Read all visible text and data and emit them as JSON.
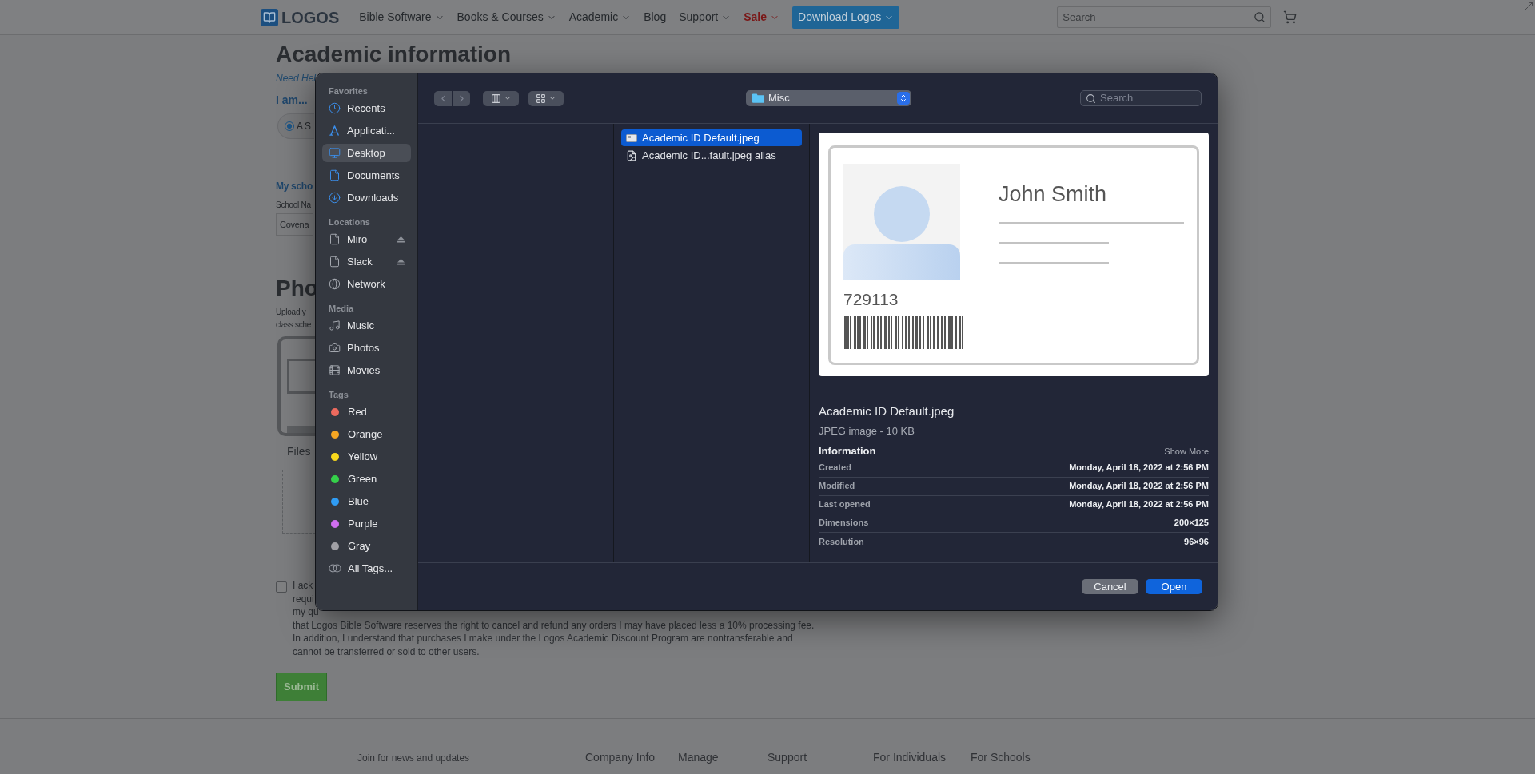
{
  "nav": {
    "logo": "LOGOS",
    "items": [
      {
        "label": "Bible Software",
        "kind": "menu"
      },
      {
        "label": "Books & Courses",
        "kind": "menu"
      },
      {
        "label": "Academic",
        "kind": "menu"
      },
      {
        "label": "Blog",
        "kind": "link"
      },
      {
        "label": "Support",
        "kind": "menu"
      },
      {
        "label": "Sale",
        "kind": "sale"
      },
      {
        "label": "Download Logos",
        "kind": "cta"
      }
    ],
    "search": {
      "placeholder": "Search"
    }
  },
  "page": {
    "title": "Academic information",
    "help_link": "Need Hel",
    "iam_label": "I am...",
    "radio": {
      "label": "A S",
      "checked": true
    },
    "school_heading": "My scho",
    "school_label": "School Na",
    "school_value": "Covena",
    "photo_heading": "Pho",
    "upload_lines": [
      "Upload y",
      "class sche"
    ],
    "files_label": "Files",
    "acknowledge": {
      "checked": false,
      "cut_lines": [
        "I ack",
        "requi",
        "my qu"
      ],
      "lines": [
        "that Logos Bible Software reserves the right to cancel and refund any orders I may have placed less a 10% processing fee.",
        "In addition, I understand that purchases I make under the Logos Academic Discount Program are nontransferable and",
        "cannot be transferred or sold to other users."
      ]
    },
    "submit": "Submit"
  },
  "footer": {
    "newsletter": "Join for news and updates",
    "columns": [
      "Company Info",
      "Manage",
      "Support",
      "For Individuals",
      "For Schools"
    ]
  },
  "dialog": {
    "sidebar": [
      {
        "heading": "Favorites",
        "items": [
          {
            "label": "Recents",
            "kind": "place",
            "selected": false
          },
          {
            "label": "Applicati...",
            "kind": "place",
            "selected": false
          },
          {
            "label": "Desktop",
            "kind": "place",
            "selected": true
          },
          {
            "label": "Documents",
            "kind": "place",
            "selected": false
          },
          {
            "label": "Downloads",
            "kind": "place",
            "selected": false
          }
        ]
      },
      {
        "heading": "Locations",
        "items": [
          {
            "label": "Miro",
            "kind": "volume",
            "ejectable": true,
            "selected": false
          },
          {
            "label": "Slack",
            "kind": "volume",
            "ejectable": true,
            "selected": false
          },
          {
            "label": "Network",
            "kind": "place",
            "selected": false
          }
        ]
      },
      {
        "heading": "Media",
        "items": [
          {
            "label": "Music",
            "kind": "place",
            "selected": false
          },
          {
            "label": "Photos",
            "kind": "place",
            "selected": false
          },
          {
            "label": "Movies",
            "kind": "place",
            "selected": false
          }
        ]
      },
      {
        "heading": "Tags",
        "items": [
          {
            "label": "Red",
            "kind": "tag",
            "color": "#ec6a5e",
            "selected": false
          },
          {
            "label": "Orange",
            "kind": "tag",
            "color": "#f5a623",
            "selected": false
          },
          {
            "label": "Yellow",
            "kind": "tag",
            "color": "#f8d81c",
            "selected": false
          },
          {
            "label": "Green",
            "kind": "tag",
            "color": "#35d04a",
            "selected": false
          },
          {
            "label": "Blue",
            "kind": "tag",
            "color": "#2f9cf4",
            "selected": false
          },
          {
            "label": "Purple",
            "kind": "tag",
            "color": "#d06ff0",
            "selected": false
          },
          {
            "label": "Gray",
            "kind": "tag",
            "color": "#a0a0a5",
            "selected": false
          },
          {
            "label": "All Tags...",
            "kind": "all_tags",
            "selected": false
          }
        ]
      }
    ],
    "location": "Misc",
    "search": {
      "placeholder": "Search"
    },
    "files": [
      {
        "name": "Academic ID Default.jpeg",
        "kind": "image",
        "selected": true
      },
      {
        "name": "Academic ID...fault.jpeg alias",
        "kind": "alias",
        "selected": false
      }
    ],
    "preview": {
      "card_name": "John Smith",
      "card_number": "729113",
      "file_name": "Academic ID Default.jpeg",
      "file_type": "JPEG image - 10 KB",
      "info_heading": "Information",
      "show_more": "Show More",
      "info": [
        {
          "label": "Created",
          "value": "Monday, April 18, 2022 at 2:56 PM"
        },
        {
          "label": "Modified",
          "value": "Monday, April 18, 2022 at 2:56 PM"
        },
        {
          "label": "Last opened",
          "value": "Monday, April 18, 2022 at 2:56 PM"
        },
        {
          "label": "Dimensions",
          "value": "200×125"
        },
        {
          "label": "Resolution",
          "value": "96×96"
        }
      ]
    },
    "buttons": {
      "cancel": "Cancel",
      "open": "Open"
    }
  }
}
